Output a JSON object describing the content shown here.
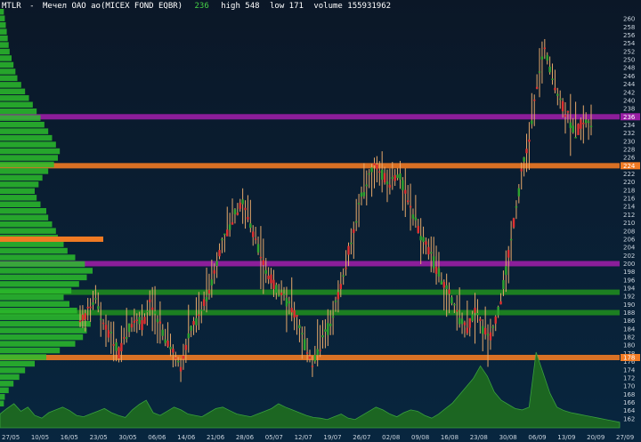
{
  "header": {
    "ticker": "MTLR",
    "separator": "-",
    "instrument": "Мечел ОАО ао(MICEX FOND EQBR)",
    "last": "236",
    "high_label": "high 548",
    "low_label": "low 171",
    "volume_label": "volume 155931962"
  },
  "colors": {
    "background_top": "#0b1727",
    "background_bottom": "#08263f",
    "up": "#2fa32f",
    "down": "#e03030",
    "candle_body": "#e6a86a",
    "volume_profile": "#2bbd2b",
    "volume_area": "#1f6e1f",
    "level_orange": "#f07a23",
    "level_purple": "#9a1ea5",
    "level_green": "#1f8a1f",
    "text": "#c9d3dd",
    "last_price": "#46d046"
  },
  "chart_data": {
    "type": "candlestick",
    "ylim": [
      160,
      262
    ],
    "y_ticks": [
      162,
      164,
      166,
      168,
      170,
      172,
      174,
      176,
      178,
      180,
      182,
      184,
      186,
      188,
      190,
      192,
      194,
      196,
      198,
      200,
      202,
      204,
      206,
      208,
      210,
      212,
      214,
      216,
      218,
      220,
      222,
      224,
      226,
      228,
      230,
      232,
      234,
      236,
      238,
      240,
      242,
      244,
      246,
      248,
      250,
      252,
      254,
      256,
      258,
      260
    ],
    "x_labels": [
      "27/05",
      "10/05",
      "16/05",
      "23/05",
      "30/05",
      "06/06",
      "14/06",
      "21/06",
      "28/06",
      "05/07",
      "12/07",
      "19/07",
      "26/07",
      "02/08",
      "09/08",
      "16/08",
      "23/08",
      "30/08",
      "06/09",
      "13/09",
      "20/09",
      "27/09"
    ],
    "levels": [
      {
        "price": 236,
        "color": "#9a1ea5",
        "label": "236"
      },
      {
        "price": 224,
        "color": "#f07a23",
        "label": "224"
      },
      {
        "price": 200,
        "color": "#9a1ea5"
      },
      {
        "price": 193,
        "color": "#1f8a1f"
      },
      {
        "price": 188,
        "color": "#1f8a1f"
      },
      {
        "price": 177,
        "color": "#f07a23",
        "label": "178"
      }
    ],
    "profile_marker": {
      "price": 206,
      "color": "#f07a23"
    },
    "price_path": [
      [
        0,
        186
      ],
      [
        3,
        188
      ],
      [
        6,
        192
      ],
      [
        9,
        185
      ],
      [
        12,
        182
      ],
      [
        15,
        178
      ],
      [
        18,
        183
      ],
      [
        21,
        187
      ],
      [
        24,
        185
      ],
      [
        27,
        190
      ],
      [
        30,
        186
      ],
      [
        33,
        182
      ],
      [
        36,
        178
      ],
      [
        39,
        175
      ],
      [
        42,
        182
      ],
      [
        45,
        186
      ],
      [
        48,
        190
      ],
      [
        51,
        196
      ],
      [
        54,
        203
      ],
      [
        57,
        208
      ],
      [
        60,
        212
      ],
      [
        63,
        215
      ],
      [
        66,
        210
      ],
      [
        69,
        204
      ],
      [
        72,
        198
      ],
      [
        75,
        195
      ],
      [
        78,
        193
      ],
      [
        81,
        190
      ],
      [
        84,
        186
      ],
      [
        87,
        180
      ],
      [
        90,
        176
      ],
      [
        93,
        180
      ],
      [
        96,
        184
      ],
      [
        99,
        190
      ],
      [
        102,
        197
      ],
      [
        105,
        206
      ],
      [
        108,
        214
      ],
      [
        111,
        220
      ],
      [
        114,
        224
      ],
      [
        117,
        222
      ],
      [
        120,
        220
      ],
      [
        123,
        222
      ],
      [
        126,
        218
      ],
      [
        129,
        212
      ],
      [
        132,
        207
      ],
      [
        135,
        203
      ],
      [
        138,
        199
      ],
      [
        141,
        195
      ],
      [
        144,
        191
      ],
      [
        147,
        186
      ],
      [
        150,
        184
      ],
      [
        153,
        188
      ],
      [
        156,
        184
      ],
      [
        159,
        182
      ],
      [
        162,
        188
      ],
      [
        165,
        198
      ],
      [
        168,
        210
      ],
      [
        171,
        222
      ],
      [
        174,
        230
      ],
      [
        177,
        244
      ],
      [
        180,
        252
      ],
      [
        183,
        246
      ],
      [
        186,
        240
      ],
      [
        189,
        236
      ],
      [
        192,
        232
      ],
      [
        195,
        235
      ],
      [
        198,
        234
      ]
    ],
    "day_count": 199,
    "volume_profile": [
      4,
      5,
      9,
      14,
      20,
      26,
      36,
      48,
      62,
      78,
      86,
      90,
      94,
      88,
      80,
      72,
      66,
      74,
      82,
      90,
      96,
      88,
      78,
      70,
      66,
      60,
      58,
      54,
      50,
      48,
      42,
      38,
      36,
      40,
      44,
      50,
      56,
      60,
      62,
      58,
      54,
      50,
      46,
      42,
      38,
      34,
      30,
      26,
      22,
      18,
      16,
      14,
      12,
      10,
      9,
      8,
      7,
      6,
      5,
      4
    ],
    "volume": [
      20,
      28,
      35,
      24,
      30,
      18,
      14,
      22,
      26,
      30,
      25,
      18,
      16,
      20,
      24,
      28,
      22,
      18,
      15,
      26,
      34,
      40,
      22,
      18,
      24,
      30,
      26,
      20,
      18,
      16,
      22,
      28,
      30,
      25,
      20,
      18,
      16,
      20,
      24,
      28,
      35,
      30,
      26,
      22,
      18,
      15,
      14,
      12,
      16,
      20,
      14,
      12,
      18,
      24,
      30,
      26,
      20,
      16,
      22,
      26,
      24,
      18,
      14,
      20,
      28,
      36,
      48,
      60,
      72,
      90,
      75,
      52,
      40,
      34,
      28,
      26,
      30,
      110,
      80,
      50,
      30,
      25,
      22,
      20,
      18,
      16,
      14,
      12,
      10,
      8
    ]
  }
}
